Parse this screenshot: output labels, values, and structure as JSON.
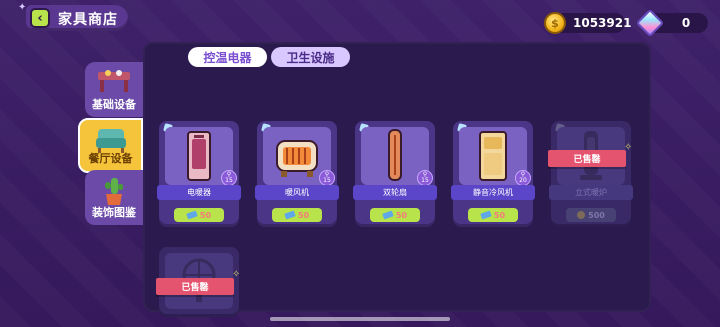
{
  "header": {
    "title": "家具商店",
    "back_icon": "chevron-left-icon"
  },
  "currency": {
    "coins": "1053921",
    "gems": "0",
    "coin_color": "#f2b51b"
  },
  "sidebar": {
    "items": [
      {
        "label": "基础设备",
        "icon": "table-icon",
        "active": false
      },
      {
        "label": "餐厅设备",
        "icon": "armchair-icon",
        "active": true
      },
      {
        "label": "装饰图鉴",
        "icon": "cactus-icon",
        "active": false
      }
    ]
  },
  "tabs": [
    {
      "label": "控温电器",
      "active": true
    },
    {
      "label": "卫生设施",
      "active": false
    }
  ],
  "items": [
    {
      "name": "电暖器",
      "price": "50",
      "level": "15",
      "sold": false,
      "icon": "radiator-heater-icon"
    },
    {
      "name": "暖风机",
      "price": "50",
      "level": "15",
      "sold": false,
      "icon": "fan-heater-icon"
    },
    {
      "name": "双轮扇",
      "price": "50",
      "level": "15",
      "sold": false,
      "icon": "tower-fan-icon"
    },
    {
      "name": "静音冷风机",
      "price": "50",
      "level": "20",
      "sold": false,
      "icon": "air-cooler-icon"
    },
    {
      "name": "立式暖炉",
      "price": "500",
      "level": "",
      "sold": true,
      "sold_label": "已售罄",
      "icon": "standing-heater-icon"
    },
    {
      "name": "",
      "price": "",
      "level": "",
      "sold": true,
      "sold_label": "已售罄",
      "icon": "desk-fan-icon"
    }
  ],
  "colors": {
    "accent": "#f5c43a",
    "price_bg": "#b8e34b",
    "sold_ribbon": "#e5546f",
    "panel": "#2a1a4d"
  }
}
